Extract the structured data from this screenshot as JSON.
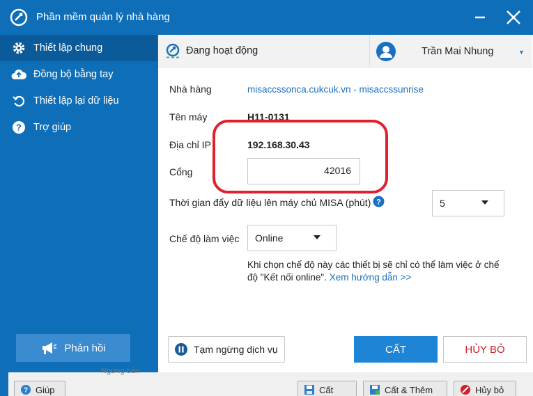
{
  "window": {
    "title": "Phần mềm quản lý nhà hàng"
  },
  "sidebar": {
    "items": [
      {
        "label": "Thiết lập chung",
        "icon": "gear-icon"
      },
      {
        "label": "Đồng bộ bằng tay",
        "icon": "cloud-upload-icon"
      },
      {
        "label": "Thiết lập lại dữ liệu",
        "icon": "undo-icon"
      },
      {
        "label": "Trợ giúp",
        "icon": "help-icon"
      }
    ],
    "feedback_label": "Phản hồi"
  },
  "topbar": {
    "status": "Đang hoạt động",
    "user_name": "Trần Mai Nhung"
  },
  "form": {
    "restaurant_label": "Nhà hàng",
    "restaurant_value": "misaccssonca.cukcuk.vn - misaccssunrise",
    "machine_label": "Tên máy",
    "machine_value": "H11-0131",
    "ip_label": "Địa chỉ IP",
    "ip_value": "192.168.30.43",
    "port_label": "Cổng",
    "port_value": "42016",
    "push_label": "Thời gian đẩy dữ liệu lên máy chủ MISA (phút)",
    "push_value": "5",
    "mode_label": "Chế độ làm việc",
    "mode_value": "Online",
    "info_text": "Khi chọn chế độ này các thiết bị sẽ chỉ có thể làm việc ở chế độ \"Kết nối online\".",
    "info_link": "Xem hướng dẫn >>"
  },
  "actions": {
    "pause_label": "Tạm ngừng dịch vụ",
    "save_label": "CẤT",
    "cancel_label": "HỦY BỎ"
  },
  "background_window": {
    "help_label": "Giúp",
    "save_label": "Cất",
    "save_add_label": "Cất & Thêm",
    "cancel_label": "Hủy bỏ",
    "ghost_text": "Ngừng bán"
  },
  "colors": {
    "primary": "#0e6fb8",
    "accent": "#1d84d6",
    "danger": "#d0202a",
    "highlight": "#e0202c"
  }
}
